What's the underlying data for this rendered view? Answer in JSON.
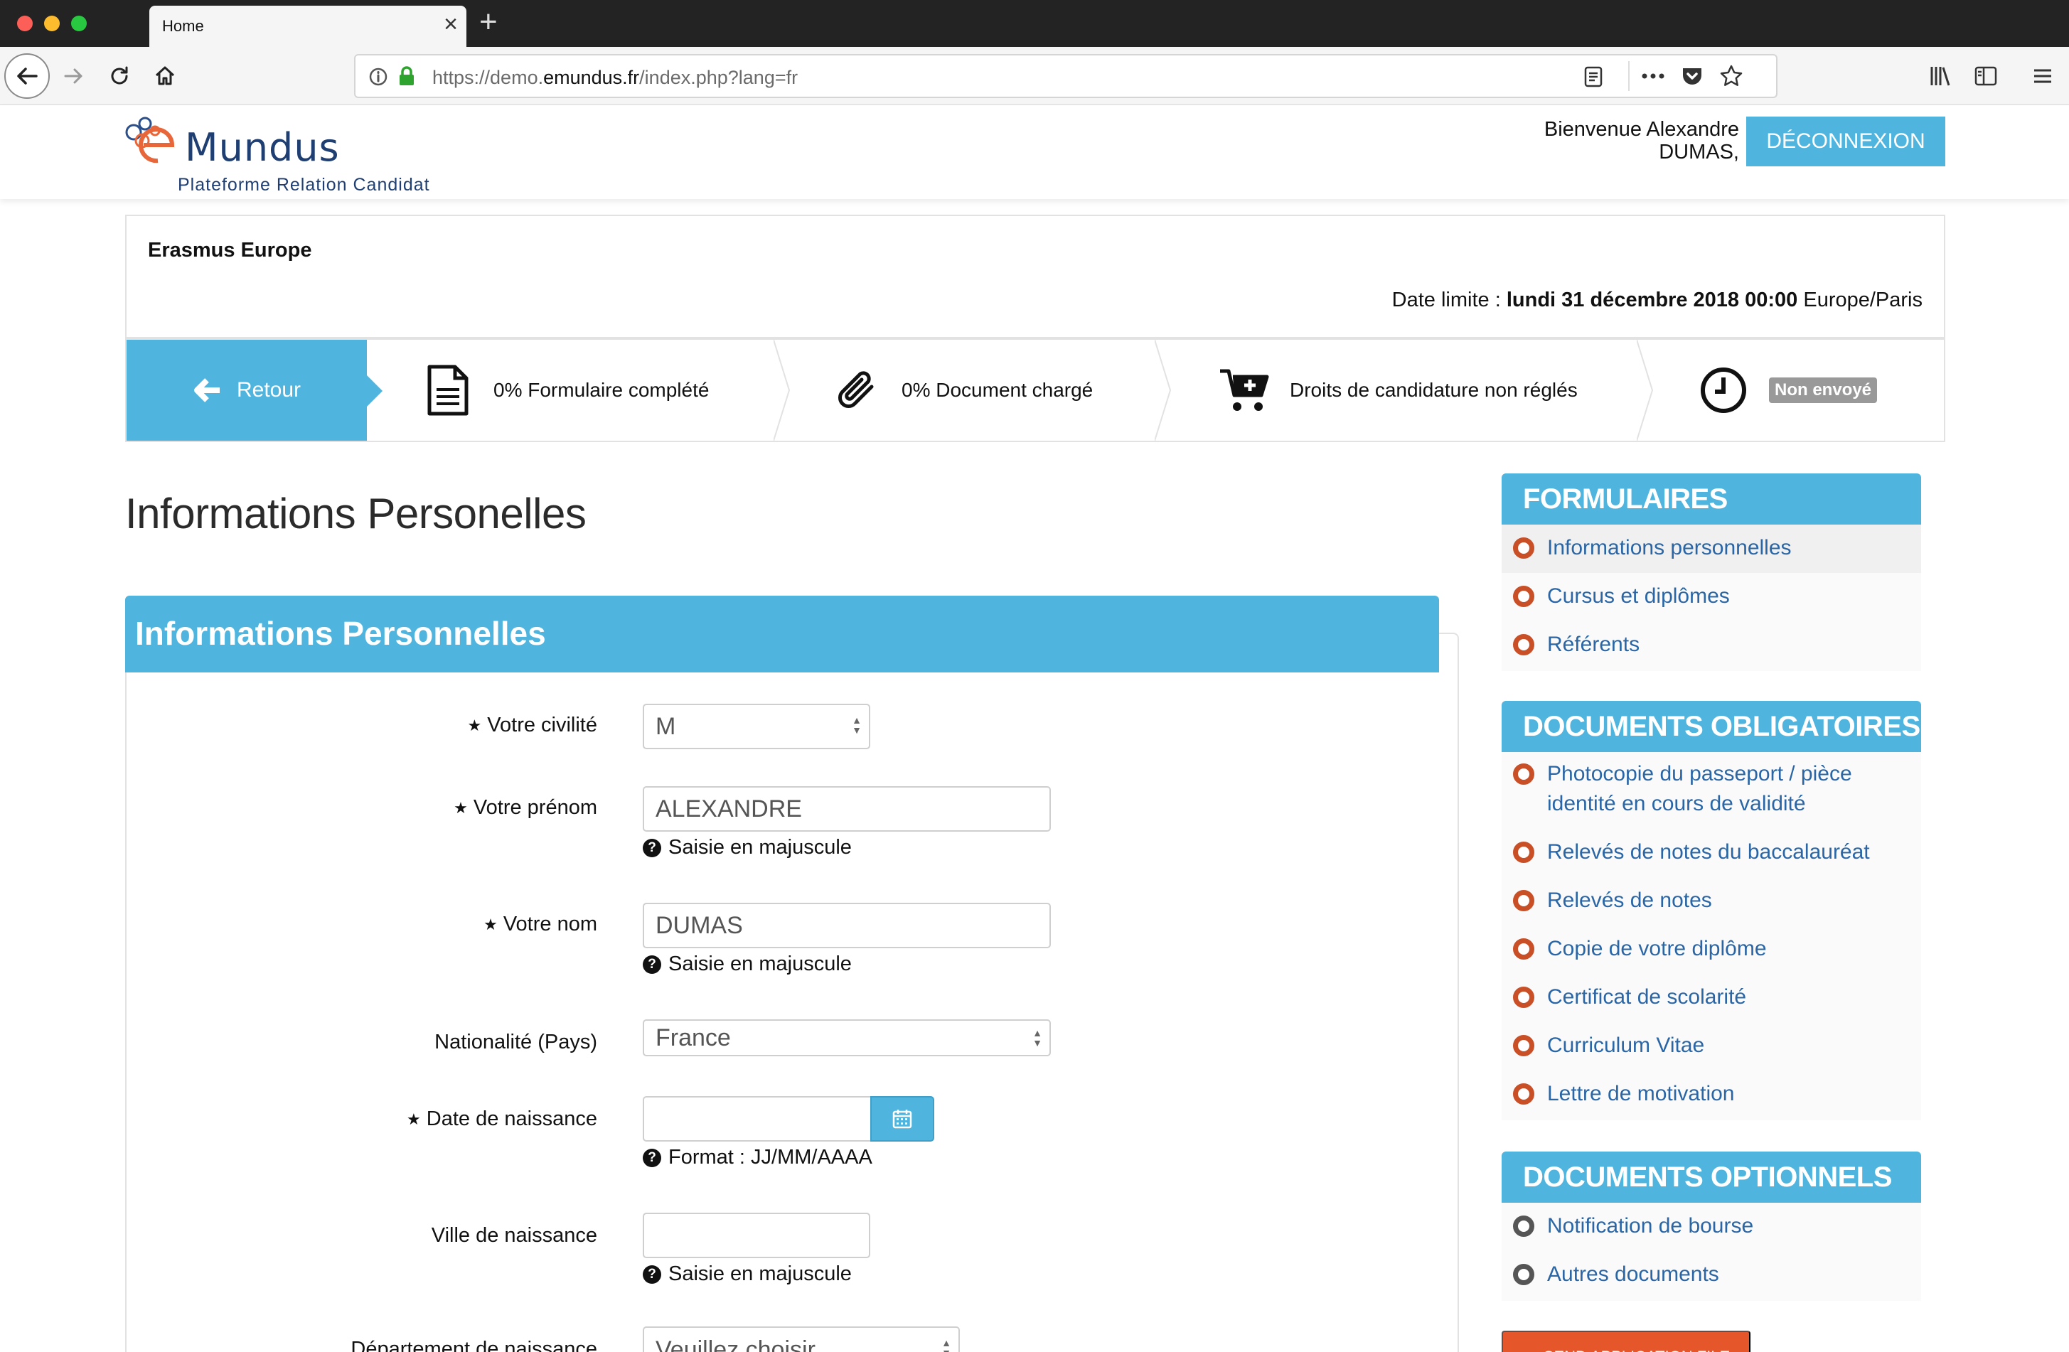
{
  "browser": {
    "tab_title": "Home",
    "tab_close": "×",
    "new_tab": "+",
    "url_prefix": "https://demo.",
    "url_domain": "emundus.fr",
    "url_suffix": "/index.php?lang=fr"
  },
  "header": {
    "logo_text": "emundus",
    "logo_subtitle": "Plateforme Relation Candidat",
    "welcome_line1": "Bienvenue Alexandre",
    "welcome_line2": "DUMAS,",
    "logout_label": "DÉCONNEXION"
  },
  "campaign": {
    "title": "Erasmus Europe",
    "deadline_prefix": "Date limite : ",
    "deadline_date": "lundi 31 décembre 2018 00:00",
    "deadline_tz": " Europe/Paris"
  },
  "steps": {
    "back_label": "Retour",
    "form_status": "0% Formulaire complété",
    "document_status": "0% Document chargé",
    "payment_status": "Droits de candidature non réglés",
    "sent_status": "Non envoyé"
  },
  "main": {
    "page_title": "Informations Personelles",
    "panel_title": "Informations Personnelles",
    "fields": {
      "civility_label": "Votre civilité",
      "civility_value": "M",
      "firstname_label": "Votre prénom",
      "firstname_value": "ALEXANDRE",
      "firstname_hint": "Saisie en majuscule",
      "lastname_label": "Votre nom",
      "lastname_value": "DUMAS",
      "lastname_hint": "Saisie en majuscule",
      "nationality_label": "Nationalité (Pays)",
      "nationality_value": "France",
      "birthdate_label": "Date de naissance",
      "birthdate_value": "",
      "birthdate_hint": "Format : JJ/MM/AAAA",
      "birthcity_label": "Ville de naissance",
      "birthcity_value": "",
      "birthcity_hint": "Saisie en majuscule",
      "department_label": "Département de naissance",
      "department_value": "Veuillez choisir"
    }
  },
  "sidebar": {
    "forms_title": "FORMULAIRES",
    "forms": [
      "Informations personnelles",
      "Cursus et diplômes",
      "Référents"
    ],
    "mandatory_title": "DOCUMENTS OBLIGATOIRES",
    "mandatory": [
      "Photocopie du passeport / pièce identité en cours de validité",
      "Relevés de notes du baccalauréat",
      "Relevés de notes",
      "Copie de votre diplôme",
      "Certificat de scolarité",
      "Curriculum Vitae",
      "Lettre de motivation"
    ],
    "optional_title": "DOCUMENTS OPTIONNELS",
    "optional": [
      "Notification de bourse",
      "Autres documents"
    ],
    "send_label": "SEND APPLICATION FILE"
  },
  "colors": {
    "accent": "#4fb5de",
    "link": "#2a66a5",
    "bullet": "#c84f26",
    "send_button": "#e5562b"
  }
}
